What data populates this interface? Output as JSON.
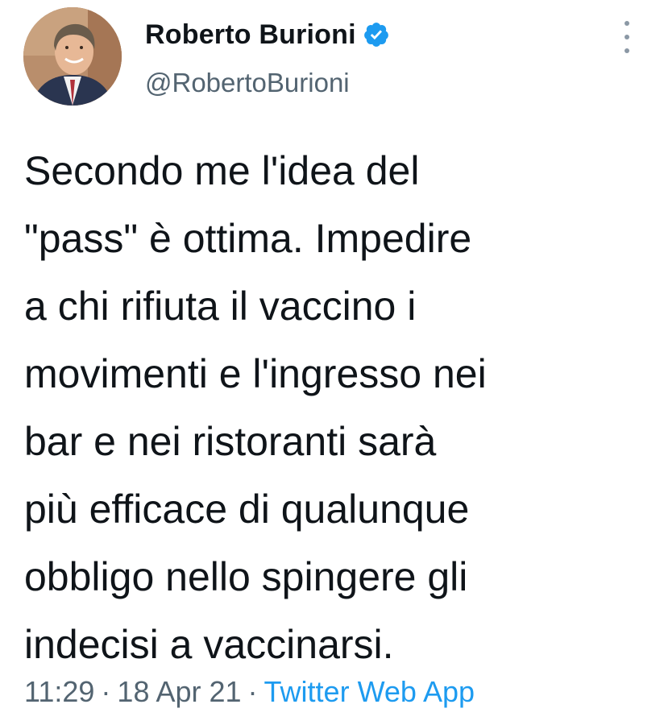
{
  "author": {
    "display_name": "Roberto Burioni",
    "handle": "@RobertoBurioni",
    "verified": true
  },
  "icons": {
    "verified": "verified-badge-icon",
    "more": "more-vertical-icon"
  },
  "tweet": {
    "lines": [
      "Secondo me l'idea del",
      "\"pass\" è ottima. Impedire",
      "a chi rifiuta il vaccino i",
      "movimenti e l'ingresso nei",
      "bar e nei ristoranti sarà",
      "più efficace di qualunque",
      "obbligo nello spingere gli",
      "indecisi a vaccinarsi."
    ]
  },
  "meta": {
    "time": "11:29",
    "separator": "·",
    "date": "18 Apr 21",
    "source": "Twitter Web App"
  },
  "colors": {
    "text": "#0f1419",
    "secondary": "#536471",
    "link": "#1d9bf0",
    "verified": "#1d9bf0"
  }
}
